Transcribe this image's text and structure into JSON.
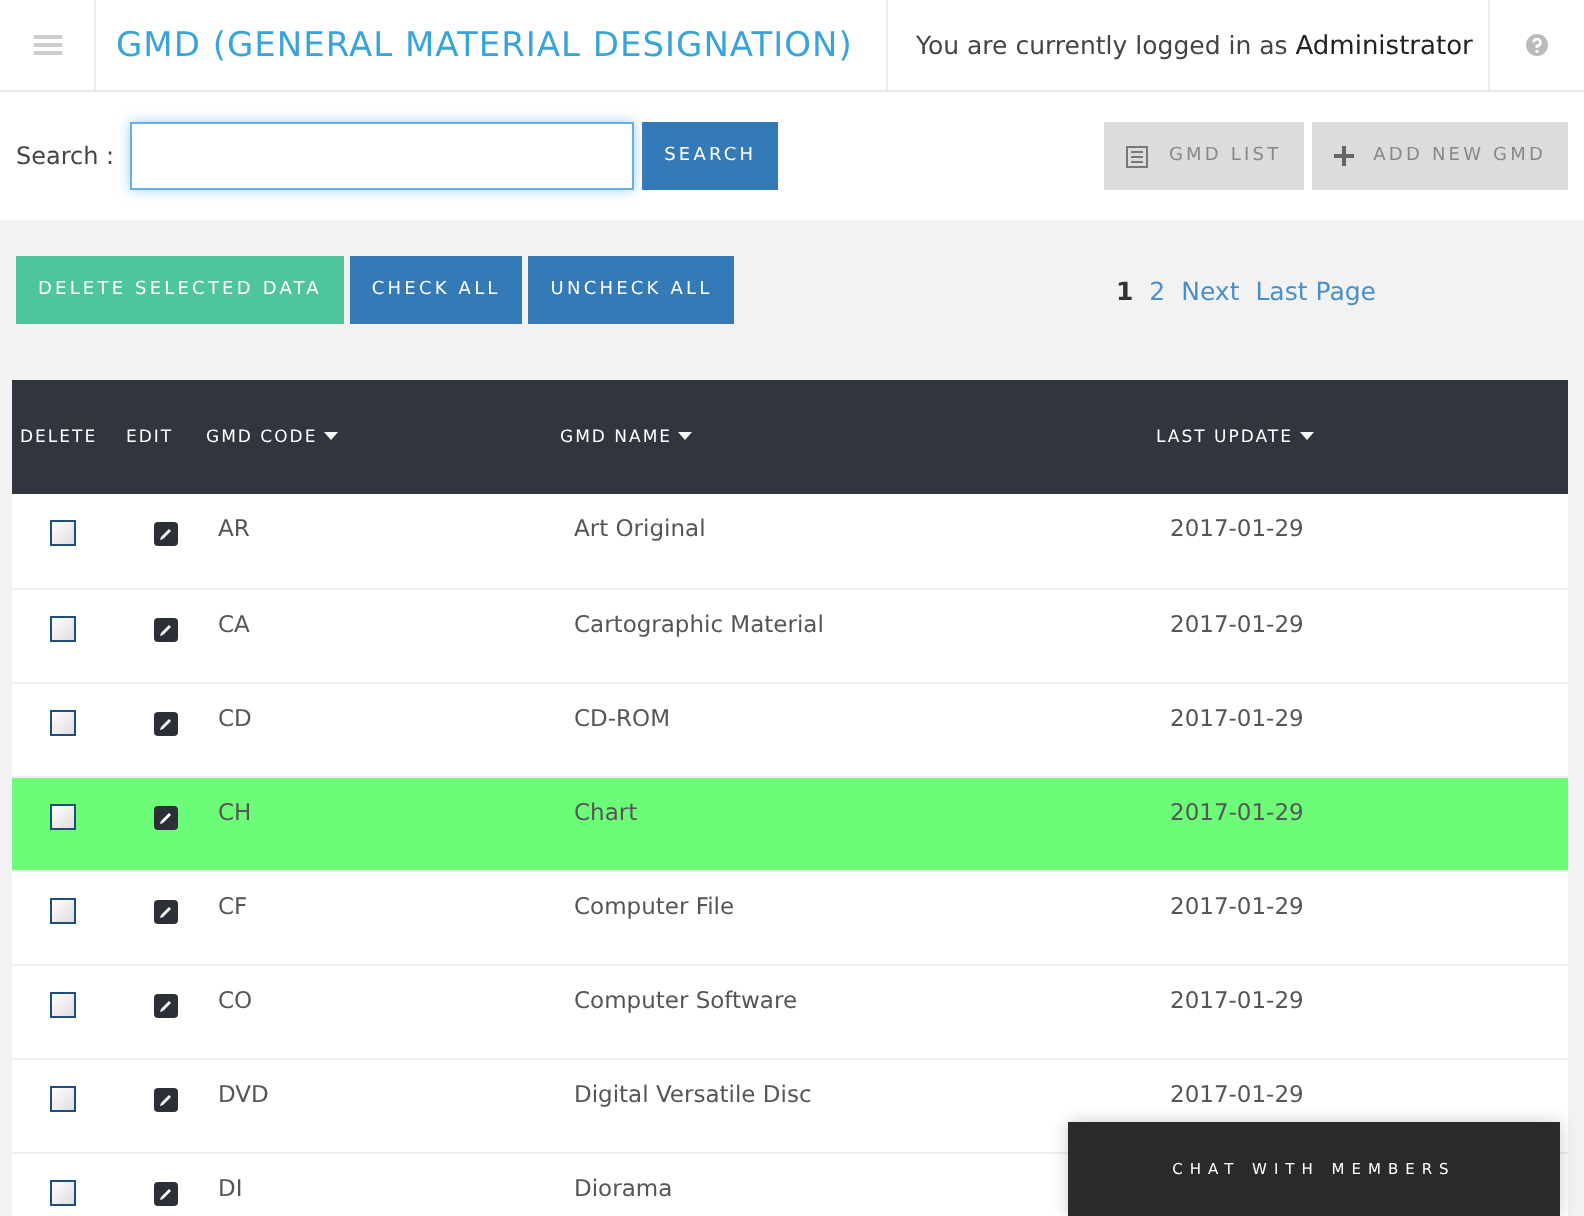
{
  "header": {
    "title": "GMD (GENERAL MATERIAL DESIGNATION)",
    "login_text": "You are currently logged in as ",
    "user": "Administrator"
  },
  "search": {
    "label": "Search :",
    "button": "SEARCH"
  },
  "nav_buttons": [
    {
      "kind": "list",
      "label": "GMD LIST"
    },
    {
      "kind": "add",
      "label": "ADD NEW GMD"
    }
  ],
  "actions": [
    {
      "kind": "delete",
      "label": "DELETE SELECTED DATA"
    },
    {
      "kind": "plain",
      "label": "CHECK ALL"
    },
    {
      "kind": "plain",
      "label": "UNCHECK ALL"
    }
  ],
  "pagination": [
    {
      "label": "1",
      "selected": true
    },
    {
      "label": "2",
      "selected": false
    },
    {
      "label": "Next",
      "selected": false
    },
    {
      "label": "Last Page",
      "selected": false
    }
  ],
  "table": {
    "columns": [
      {
        "label": "DELETE",
        "sortable": false
      },
      {
        "label": "EDIT",
        "sortable": false
      },
      {
        "label": "GMD CODE",
        "sortable": true
      },
      {
        "label": "GMD NAME",
        "sortable": true
      },
      {
        "label": "LAST UPDATE",
        "sortable": true
      }
    ],
    "rows": [
      {
        "checked": false,
        "highlighted": false,
        "code": "AR",
        "name": "Art Original",
        "date": "2017-01-29"
      },
      {
        "checked": false,
        "highlighted": false,
        "code": "CA",
        "name": "Cartographic Material",
        "date": "2017-01-29"
      },
      {
        "checked": false,
        "highlighted": false,
        "code": "CD",
        "name": "CD-ROM",
        "date": "2017-01-29"
      },
      {
        "checked": false,
        "highlighted": true,
        "code": "CH",
        "name": "Chart",
        "date": "2017-01-29"
      },
      {
        "checked": false,
        "highlighted": false,
        "code": "CF",
        "name": "Computer File",
        "date": "2017-01-29"
      },
      {
        "checked": false,
        "highlighted": false,
        "code": "CO",
        "name": "Computer Software",
        "date": "2017-01-29"
      },
      {
        "checked": false,
        "highlighted": false,
        "code": "DVD",
        "name": "Digital Versatile Disc",
        "date": "2017-01-29"
      },
      {
        "checked": false,
        "highlighted": false,
        "code": "DI",
        "name": "Diorama"
      }
    ]
  },
  "chat": {
    "label": "CHAT WITH MEMBERS"
  }
}
